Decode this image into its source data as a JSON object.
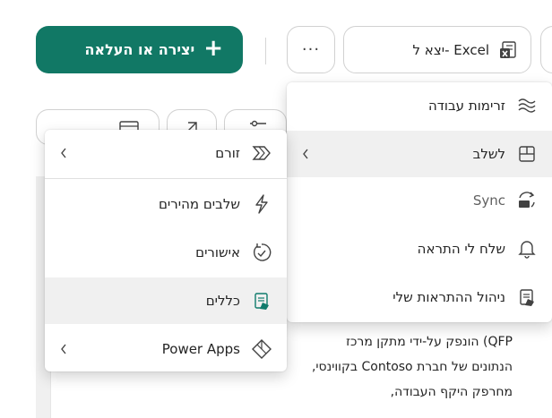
{
  "toolbar": {
    "create_label": "יצירה או העלאה",
    "more_label": "···",
    "export_label": "יצא ל- Excel"
  },
  "document": {
    "lines": [
      "QFP) הונפק על-ידי מתקן מרכז",
      "הנתונים של חברת Contoso בקווינסי,",
      "מחרפק היקף העבודה,"
    ]
  },
  "main_menu": {
    "items": [
      {
        "label": "זרימות עבודה",
        "icon": "flow-icon"
      },
      {
        "label": "לשלב",
        "icon": "integrate-icon",
        "submenu": true,
        "active": true
      },
      {
        "label": "Sync",
        "icon": "sync-icon",
        "disabled": true
      },
      {
        "label": "שלח לי התראה",
        "icon": "bell-icon"
      },
      {
        "label": "ניהול ההתראות שלי",
        "icon": "manage-alerts-icon"
      }
    ]
  },
  "sub_menu": {
    "items": [
      {
        "label": "זורם",
        "icon": "power-automate-icon",
        "submenu": true
      },
      {
        "label": "שלבים מהירים",
        "icon": "quick-steps-icon"
      },
      {
        "label": "אישורים",
        "icon": "approvals-icon"
      },
      {
        "label": "כללים",
        "icon": "rules-icon",
        "active": true
      },
      {
        "label": "Power Apps",
        "icon": "power-apps-icon",
        "submenu": true
      }
    ]
  },
  "colors": {
    "accent": "#117865",
    "excel_green": "#107C41",
    "menu_highlight": "#f0f0f0",
    "rules_icon_teal": "#0F7B6C"
  }
}
